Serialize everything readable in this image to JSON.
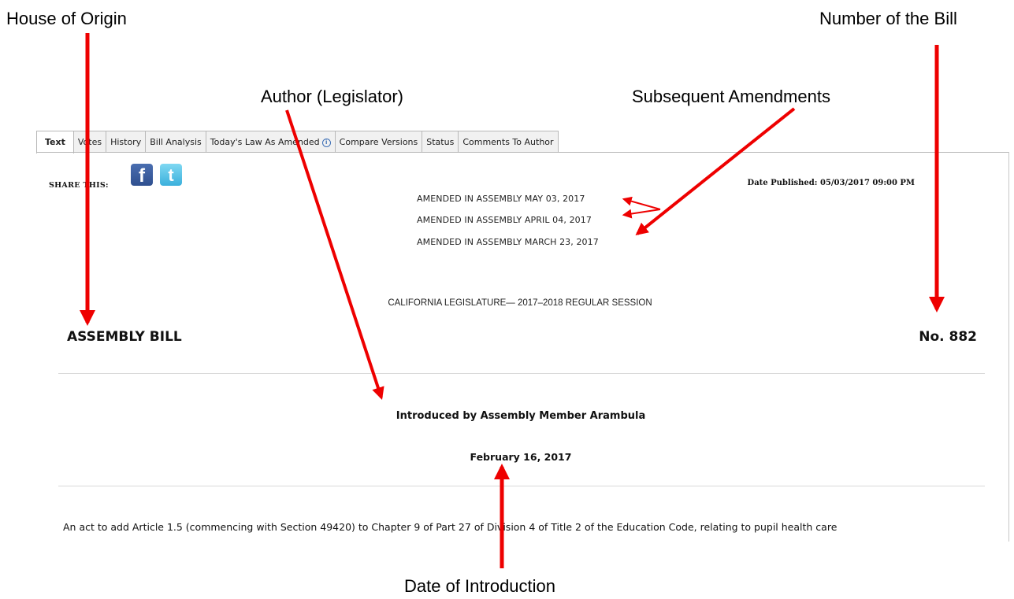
{
  "annotations": {
    "house_of_origin": "House of Origin",
    "number_of_bill": "Number of the Bill",
    "author": "Author (Legislator)",
    "subsequent_amendments": "Subsequent Amendments",
    "date_of_introduction": "Date of Introduction"
  },
  "tabs": [
    {
      "label": "Text",
      "active": true
    },
    {
      "label": "Votes"
    },
    {
      "label": "History"
    },
    {
      "label": "Bill Analysis"
    },
    {
      "label": "Today's Law As Amended"
    },
    {
      "label": "Compare Versions"
    },
    {
      "label": "Status"
    },
    {
      "label": "Comments To Author"
    }
  ],
  "share": {
    "label": "SHARE THIS:",
    "facebook_icon": "f",
    "twitter_icon": "t"
  },
  "date_published": "Date Published: 05/03/2017 09:00 PM",
  "amendments": [
    "AMENDED  IN  ASSEMBLY  MAY 03, 2017",
    "AMENDED  IN  ASSEMBLY  APRIL 04, 2017",
    "AMENDED  IN  ASSEMBLY  MARCH 23, 2017"
  ],
  "session": "CALIFORNIA LEGISLATURE— 2017–2018 REGULAR SESSION",
  "house": "ASSEMBLY BILL",
  "bill_number": "No. 882",
  "introduced_by": "Introduced by Assembly Member Arambula",
  "introduced_date": "February 16, 2017",
  "act_text": "An act to add Article 1.5 (commencing with Section 49420) to Chapter 9 of Part 27 of Division 4 of Title 2 of the Education Code, relating to pupil health care",
  "colors": {
    "arrow": "#ee0000",
    "tab_border": "#b8b8b8",
    "facebook": "#3b5998",
    "twitter": "#55acee"
  }
}
